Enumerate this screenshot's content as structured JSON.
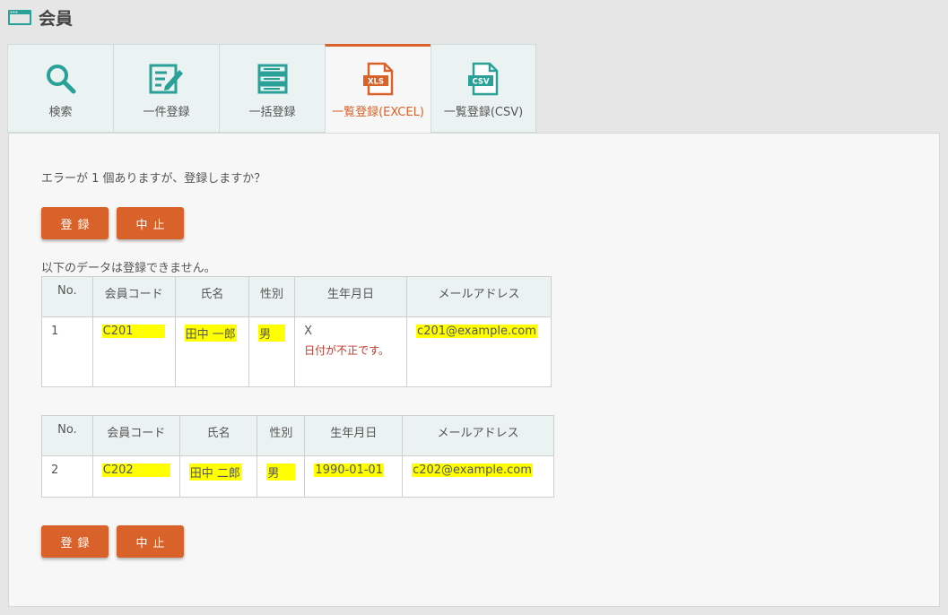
{
  "header": {
    "title": "会員",
    "icon": "window-icon"
  },
  "tabs": [
    {
      "label": "検索",
      "icon": "search-icon",
      "active": false
    },
    {
      "label": "一件登録",
      "icon": "edit-form-icon",
      "active": false
    },
    {
      "label": "一括登録",
      "icon": "list-stack-icon",
      "active": false
    },
    {
      "label": "一覧登録(EXCEL)",
      "icon": "xls-file-icon",
      "active": true,
      "badge": "XLS"
    },
    {
      "label": "一覧登録(CSV)",
      "icon": "csv-file-icon",
      "active": false,
      "badge": "CSV"
    }
  ],
  "message": "エラーが 1 個ありますが、登録しますか？",
  "buttons": {
    "register": "登録",
    "cancel": "中止"
  },
  "note": "以下のデータは登録できません。",
  "columns": [
    "No.",
    "会員コード",
    "氏名",
    "性別",
    "生年月日",
    "メールアドレス"
  ],
  "error_rows": [
    {
      "no": "1",
      "code": "C201",
      "name": "田中 一郎",
      "gender": "男",
      "birth": "X",
      "birth_error": "日付が不正です。",
      "email": "c201@example.com"
    }
  ],
  "ok_rows": [
    {
      "no": "2",
      "code": "C202",
      "name": "田中 二郎",
      "gender": "男",
      "birth": "1990-01-01",
      "email": "c202@example.com"
    }
  ],
  "colors": {
    "accent": "#d9622b",
    "teal": "#2aa198",
    "highlight": "#ffff00",
    "error": "#c0392b"
  }
}
